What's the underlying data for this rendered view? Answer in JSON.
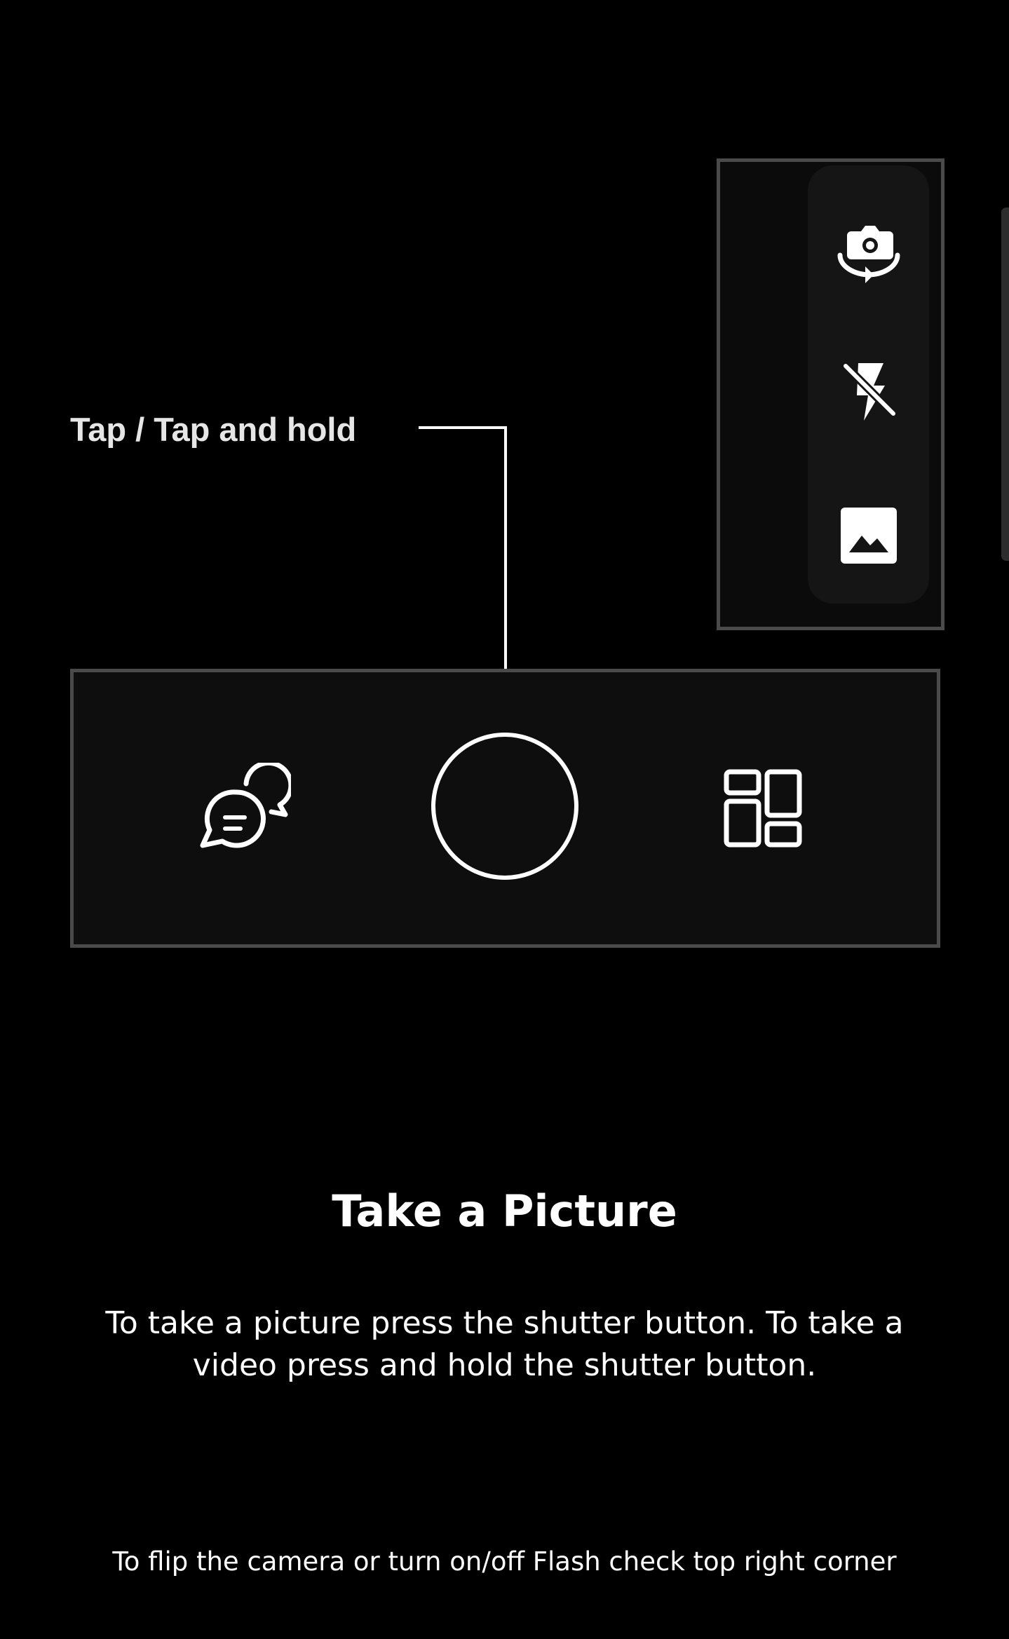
{
  "callout": {
    "label": "Tap / Tap and hold"
  },
  "camera_controls": {
    "side_panel": [
      {
        "name": "flip-camera",
        "icon": "camera-flip-icon"
      },
      {
        "name": "flash-off",
        "icon": "flash-off-icon"
      },
      {
        "name": "gallery",
        "icon": "image-gallery-icon"
      }
    ],
    "bottom_bar": [
      {
        "name": "chat",
        "icon": "chat-bubbles-icon"
      },
      {
        "name": "shutter",
        "icon": "shutter-circle"
      },
      {
        "name": "layout",
        "icon": "grid-layout-icon"
      }
    ]
  },
  "content": {
    "title": "Take a Picture",
    "description": "To take a picture press the shutter button. To take a video press and hold the shutter button.",
    "footer_tip": "To flip the camera or turn on/off Flash check top right corner"
  },
  "colors": {
    "background": "#000000",
    "panel_border": "#4a4a4a",
    "foreground": "#ffffff"
  }
}
